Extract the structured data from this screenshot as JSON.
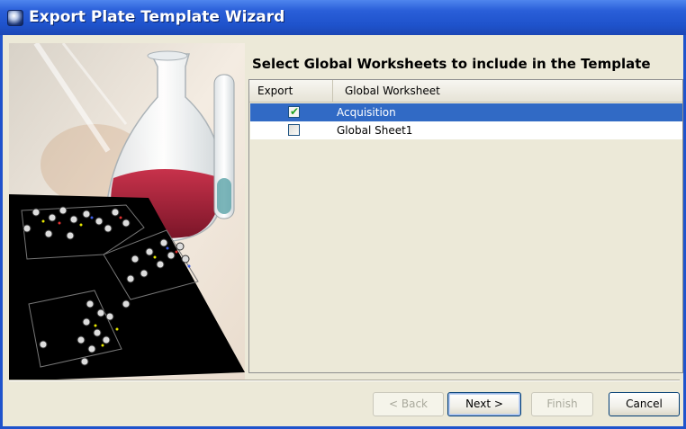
{
  "window": {
    "title": "Export Plate Template Wizard"
  },
  "heading": "Select Global Worksheets to include in the Template",
  "table": {
    "columns": [
      "Export",
      "Global Worksheet"
    ],
    "rows": [
      {
        "name": "Acquisition",
        "checked": true,
        "selected": true
      },
      {
        "name": "Global Sheet1",
        "checked": false,
        "selected": false
      }
    ]
  },
  "buttons": {
    "back": "< Back",
    "next": "Next >",
    "finish": "Finish",
    "cancel": "Cancel"
  },
  "icons": {
    "app": "app-icon",
    "illustration": "lab-flask-plot-illustration",
    "checkmark": "checkmark-icon"
  },
  "colors": {
    "titlebar": "#1f53cc",
    "selection": "#316ac5",
    "background": "#ece9d8"
  }
}
